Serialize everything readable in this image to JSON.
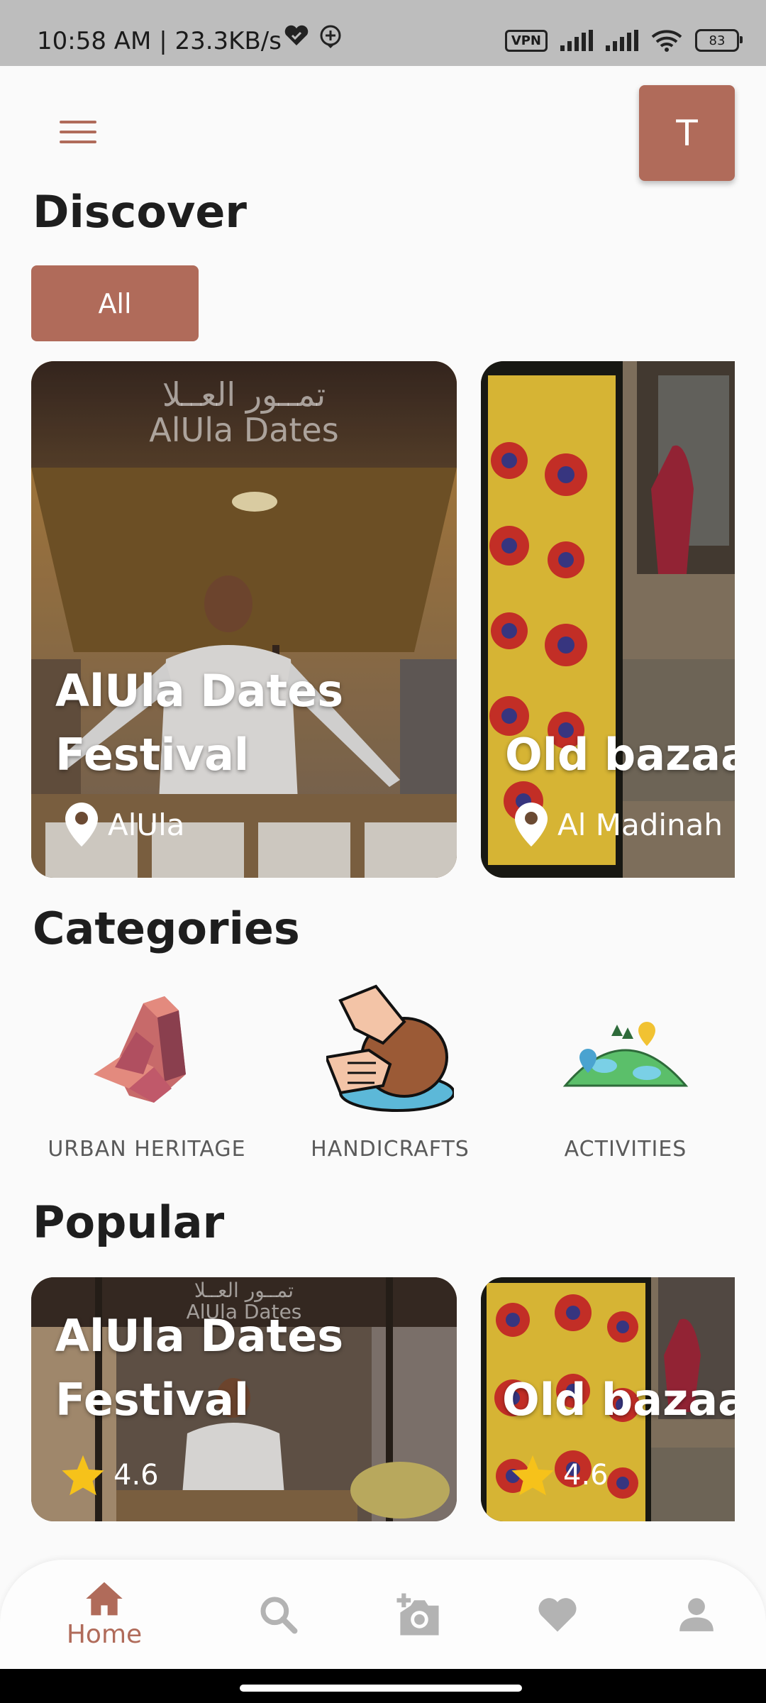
{
  "status_bar": {
    "time": "10:58 AM | 23.3KB/s",
    "vpn": "VPN",
    "battery": "83"
  },
  "header": {
    "avatar_letter": "T"
  },
  "discover": {
    "title": "Discover",
    "filter_all": "All",
    "cards": [
      {
        "title_line1": "AlUla Dates",
        "title_line2": "Festival",
        "location": "AlUla",
        "sign_ar": "تمــور العــلا",
        "sign_en": "AlUla Dates"
      },
      {
        "title_line1": "Old bazaar",
        "location": "Al Madinah"
      }
    ]
  },
  "categories": {
    "title": "Categories",
    "items": [
      {
        "label": "URBAN HERITAGE",
        "icon": "rock-formation-icon"
      },
      {
        "label": "HANDICRAFTS",
        "icon": "pottery-hands-icon"
      },
      {
        "label": "ACTIVITIES",
        "icon": "hill-map-icon"
      }
    ]
  },
  "popular": {
    "title": "Popular",
    "cards": [
      {
        "title_line1": "AlUla Dates",
        "title_line2": "Festival",
        "rating": "4.6",
        "sign_ar": "تمــور العــلا",
        "sign_en": "AlUla Dates"
      },
      {
        "title_line1": "Old bazaar",
        "rating": "4.6"
      }
    ]
  },
  "bottom_nav": {
    "home_label": "Home",
    "accent": "#b06b5a",
    "inactive": "#b3b3b3"
  }
}
